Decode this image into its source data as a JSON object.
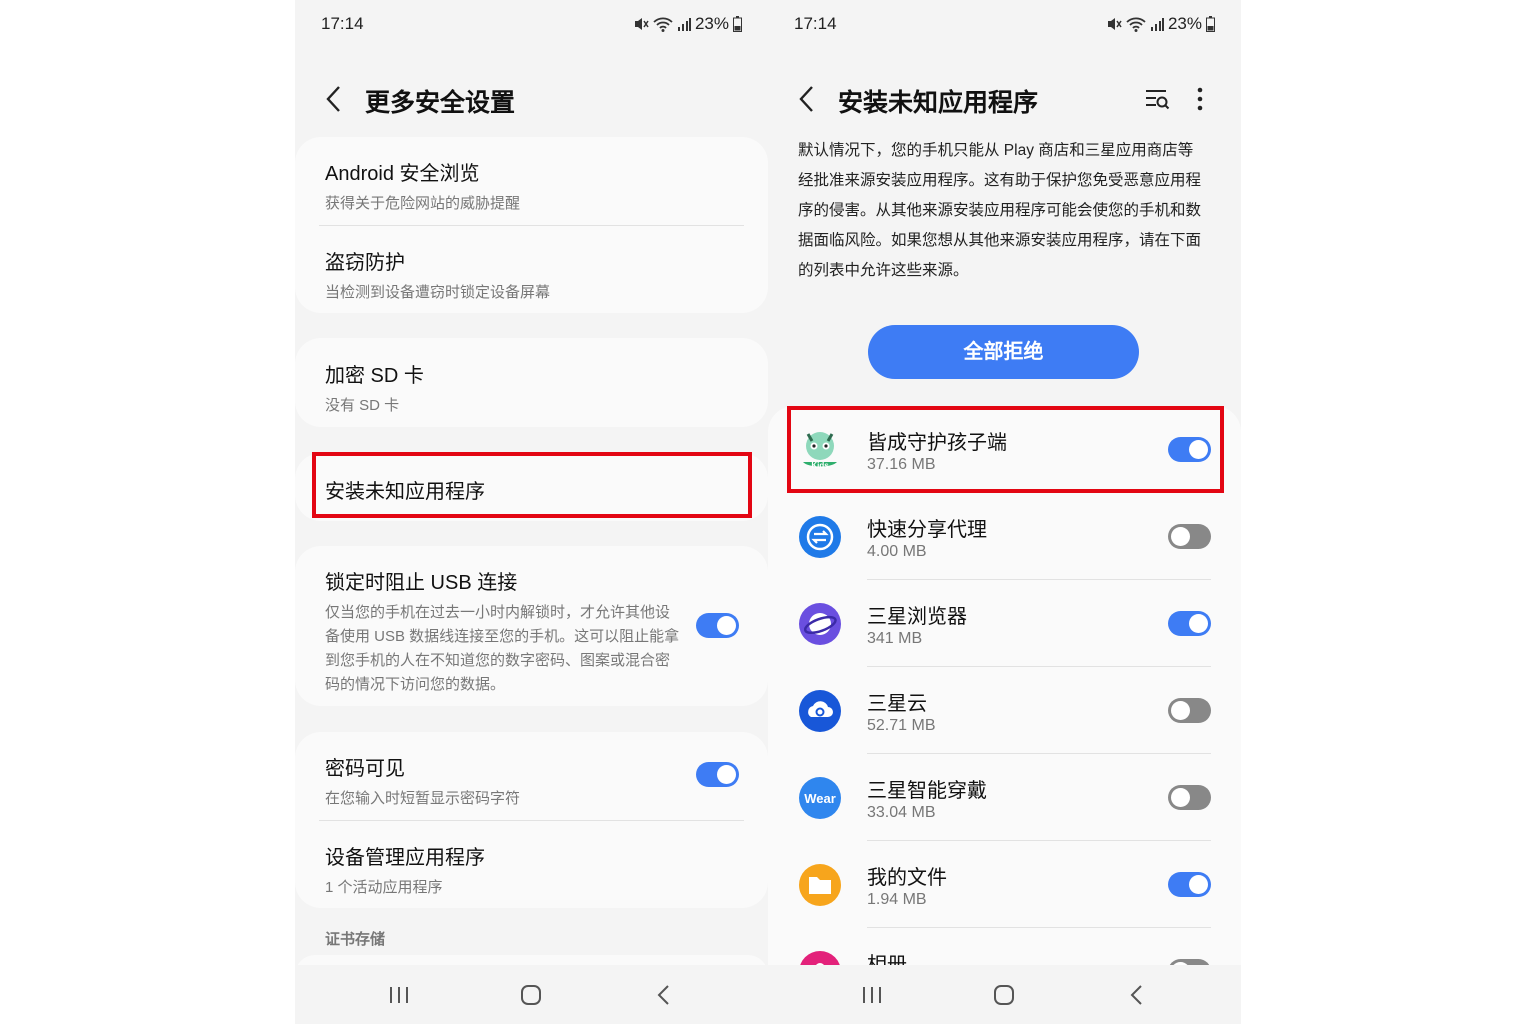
{
  "left": {
    "status": {
      "time": "17:14",
      "battery": "23%"
    },
    "title": "更多安全设置",
    "items": [
      {
        "title": "Android 安全浏览",
        "sub": "获得关于危险网站的威胁提醒"
      },
      {
        "title": "盗窃防护",
        "sub": "当检测到设备遭窃时锁定设备屏幕"
      },
      {
        "title": "加密 SD 卡",
        "sub": "没有 SD 卡"
      },
      {
        "title": "安装未知应用程序"
      },
      {
        "title": "锁定时阻止 USB 连接",
        "sub": "仅当您的手机在过去一小时内解锁时，才允许其他设备使用 USB 数据线连接至您的手机。这可以阻止能拿到您手机的人在不知道您的数字密码、图案或混合密码的情况下访问您的数据。",
        "toggle": "on"
      },
      {
        "title": "密码可见",
        "sub": "在您输入时短暂显示密码字符",
        "toggle": "on"
      },
      {
        "title": "设备管理应用程序",
        "sub": "1 个活动应用程序"
      }
    ],
    "section_label": "证书存储"
  },
  "right": {
    "status": {
      "time": "17:14",
      "battery": "23%"
    },
    "title": "安装未知应用程序",
    "description": "默认情况下，您的手机只能从 Play 商店和三星应用商店等经批准来源安装应用程序。这有助于保护您免受恶意应用程序的侵害。从其他来源安装应用程序可能会使您的手机和数据面临风险。如果您想从其他来源安装应用程序，请在下面的列表中允许这些来源。",
    "reject_all": "全部拒绝",
    "apps": [
      {
        "name": "皆成守护孩子端",
        "size": "37.16 MB",
        "toggle": "on",
        "icon": "kids-guard-icon",
        "icon_text": "Kids"
      },
      {
        "name": "快速分享代理",
        "size": "4.00 MB",
        "toggle": "off",
        "icon": "quick-share-icon"
      },
      {
        "name": "三星浏览器",
        "size": "341 MB",
        "toggle": "on",
        "icon": "samsung-internet-icon"
      },
      {
        "name": "三星云",
        "size": "52.71 MB",
        "toggle": "off",
        "icon": "samsung-cloud-icon"
      },
      {
        "name": "三星智能穿戴",
        "size": "33.04 MB",
        "toggle": "off",
        "icon": "galaxy-wearable-icon",
        "icon_text": "Wear"
      },
      {
        "name": "我的文件",
        "size": "1.94 MB",
        "toggle": "on",
        "icon": "my-files-icon"
      },
      {
        "name": "相册",
        "size": "",
        "toggle": "off",
        "icon": "gallery-icon"
      }
    ]
  },
  "colors": {
    "accent": "#3e7cf4",
    "highlight": "#e30613"
  }
}
